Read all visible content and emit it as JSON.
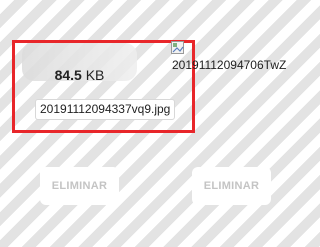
{
  "left_file": {
    "size_value": "84.5",
    "size_unit": "KB",
    "name": "20191112094337vq9.jpg",
    "remove_label": "ELIMINAR"
  },
  "right_file": {
    "alt_text": "20191112094706TwZ",
    "remove_label": "ELIMINAR"
  },
  "colors": {
    "highlight_border": "#e8262a",
    "remove_text": "#c4c4c4"
  },
  "icons": {
    "broken_image": "broken-image-icon"
  }
}
